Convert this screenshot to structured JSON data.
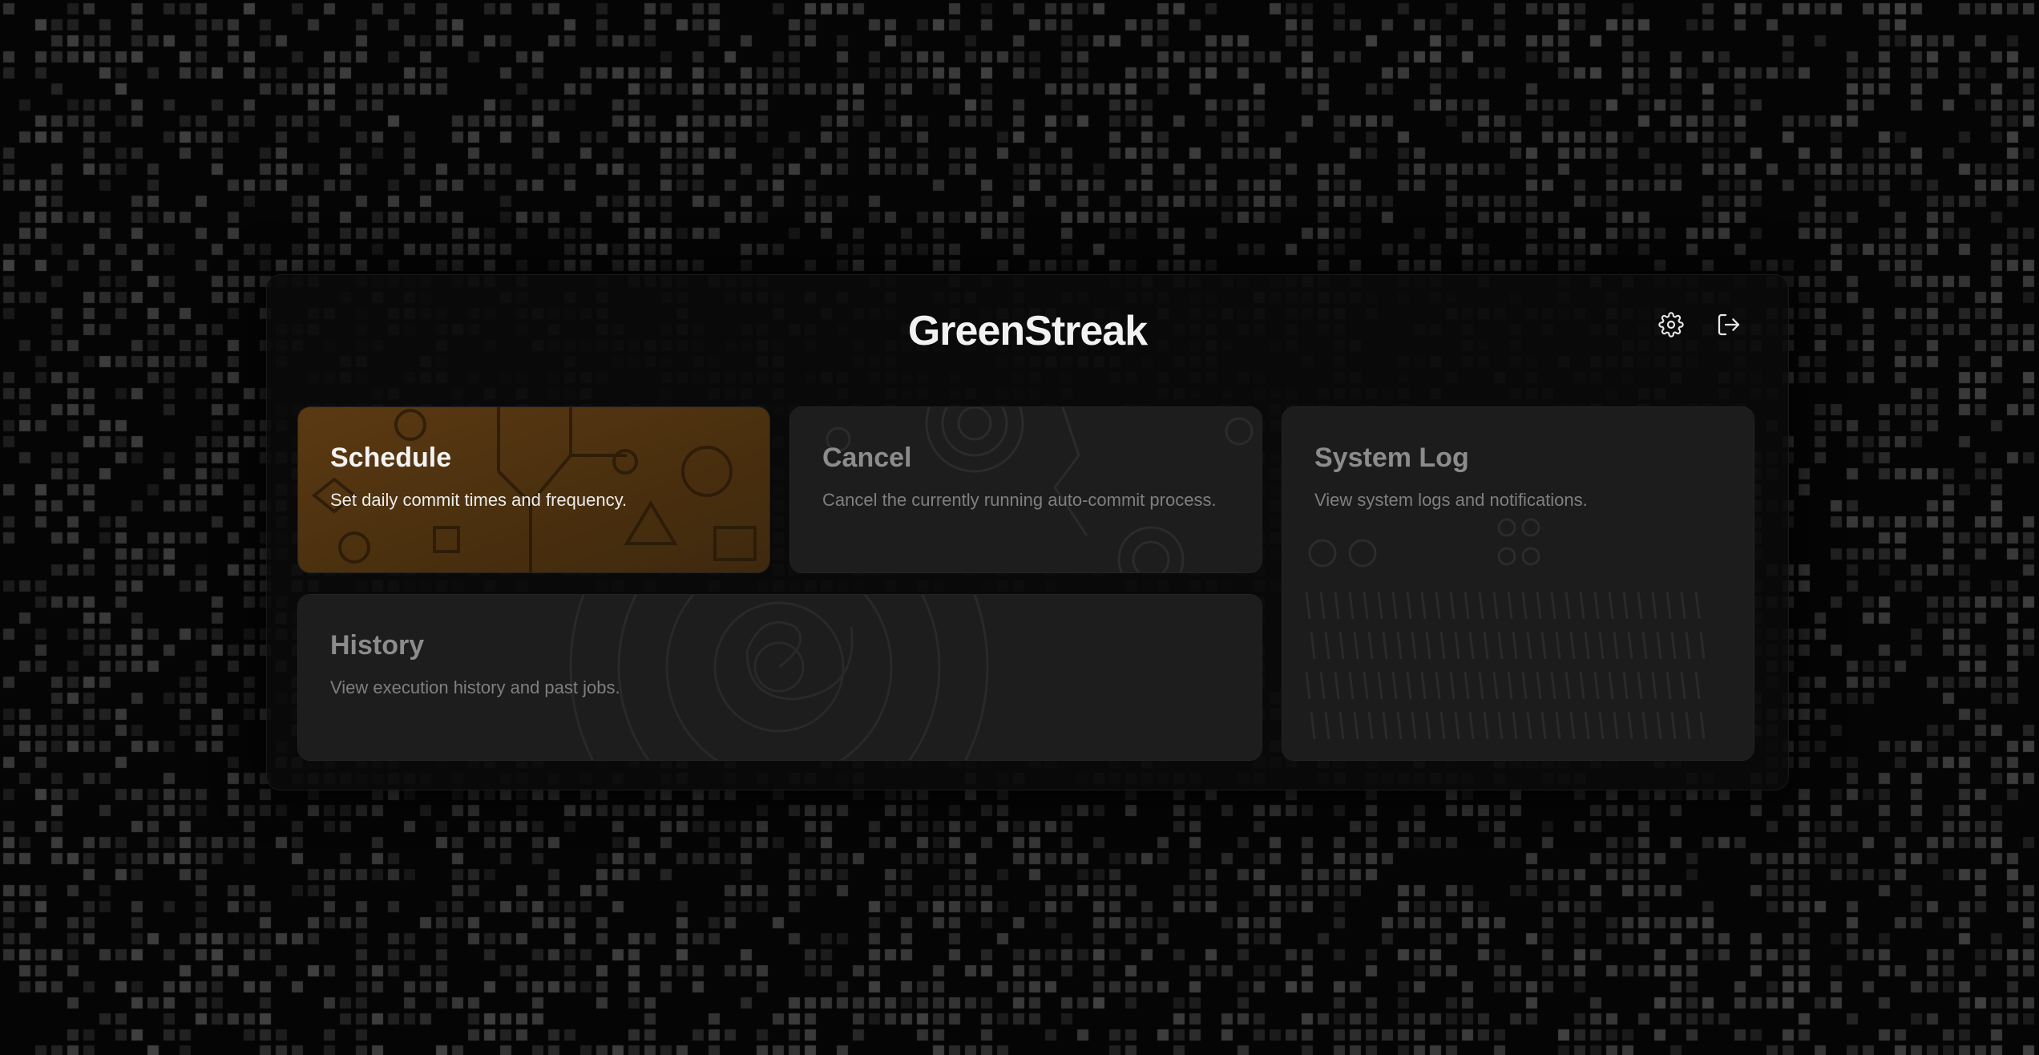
{
  "app": {
    "title": "GreenStreak"
  },
  "header": {
    "settings_icon": "gear-icon",
    "logout_icon": "logout-icon"
  },
  "cards": [
    {
      "id": "schedule",
      "title": "Schedule",
      "description": "Set daily commit times and frequency.",
      "state": "active"
    },
    {
      "id": "cancel",
      "title": "Cancel",
      "description": "Cancel the currently running auto-commit process.",
      "state": "dim"
    },
    {
      "id": "system-log",
      "title": "System Log",
      "description": "View system logs and notifications.",
      "state": "dim"
    },
    {
      "id": "history",
      "title": "History",
      "description": "View execution history and past jobs.",
      "state": "dim"
    }
  ],
  "colors": {
    "background": "#050505",
    "panel": "#0a0a0a",
    "schedule_card": "#5a3a14",
    "dim_card": "#1c1c1c",
    "text_primary": "#f2f2f2",
    "text_dim": "#8c8c8c"
  }
}
